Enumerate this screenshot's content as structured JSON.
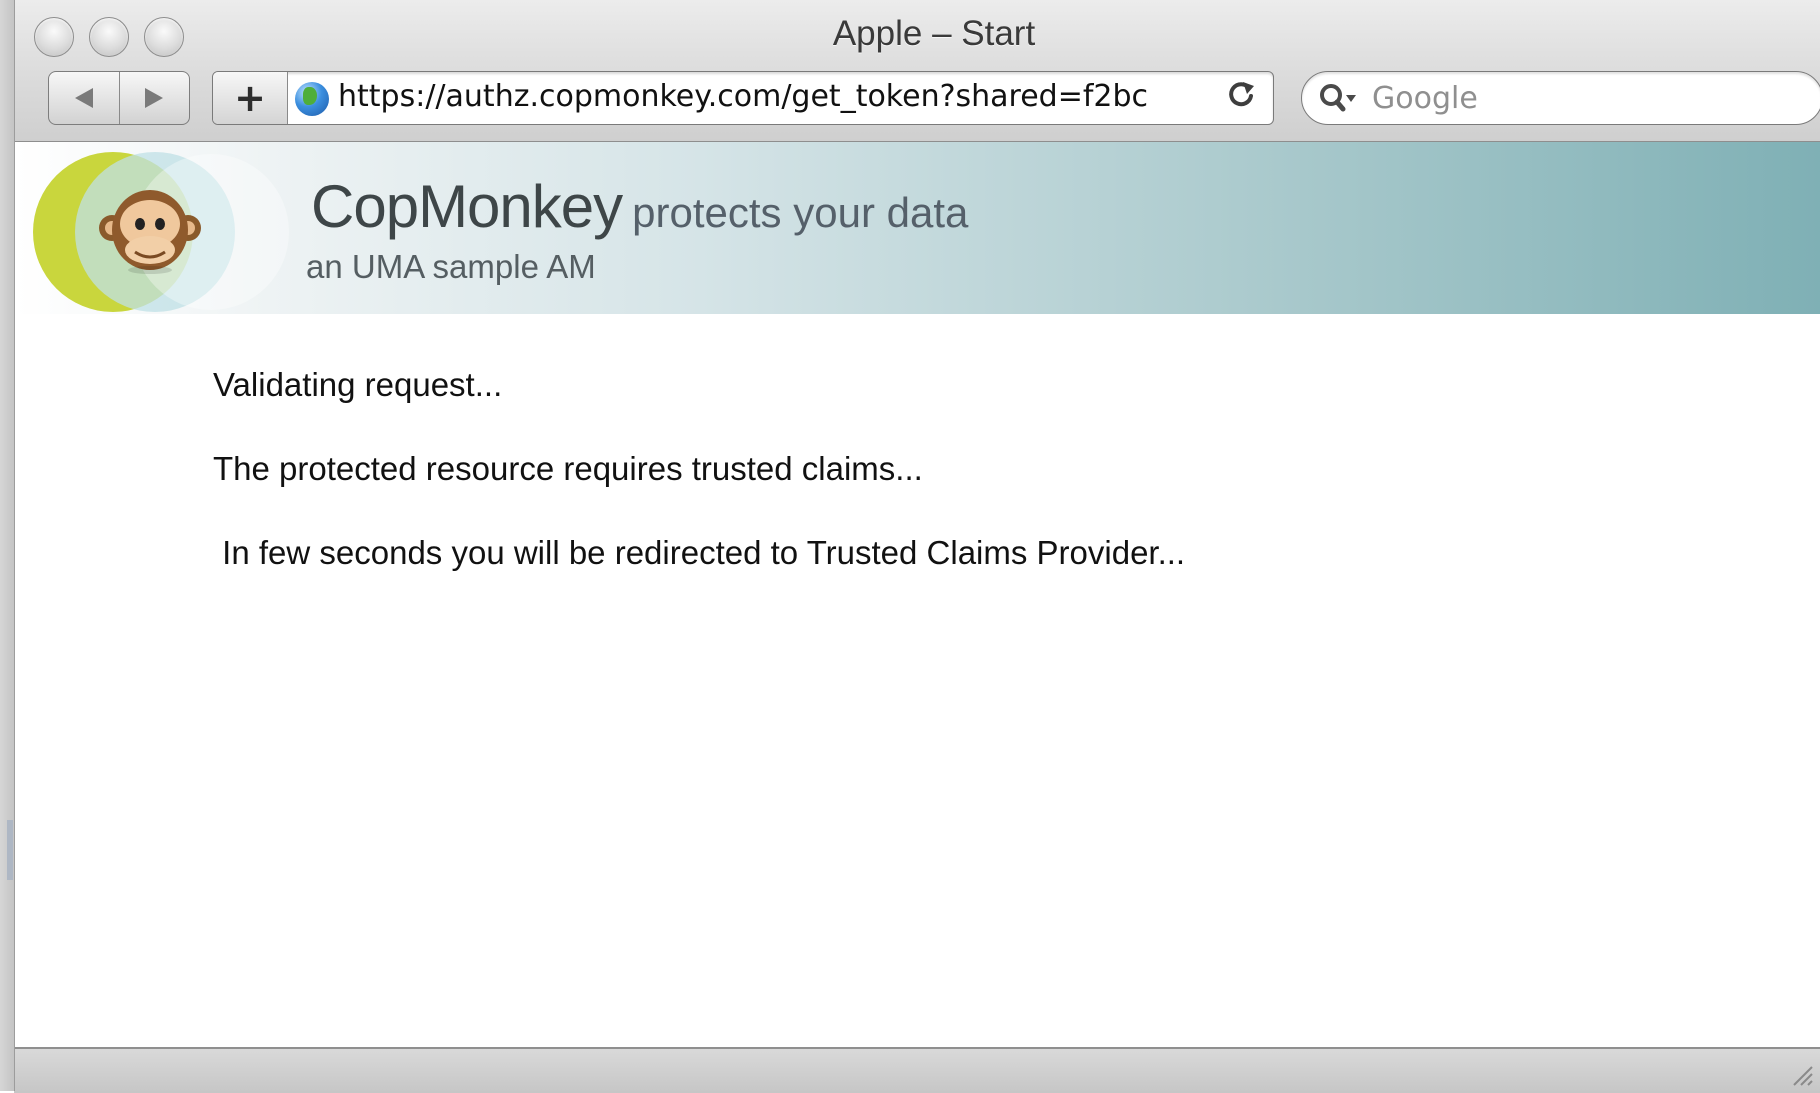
{
  "window": {
    "title": "Apple – Start"
  },
  "toolbar": {
    "back_icon": "back-arrow-icon",
    "forward_icon": "forward-arrow-icon",
    "add_label": "+",
    "url": "https://authz.copmonkey.com/get_token?shared=f2bc",
    "reload_icon": "reload-icon",
    "search_placeholder": "Google"
  },
  "banner": {
    "brand_name": "CopMonkey",
    "tagline": "protects your data",
    "subtitle": "an UMA sample AM",
    "colors": {
      "gradient_start": "#ffffff",
      "gradient_end": "#7fb0b5",
      "logo_yellow": "#c9d63d",
      "logo_blue": "#bfe0e6"
    }
  },
  "messages": [
    "Validating request...",
    "The protected resource requires trusted claims...",
    " In few seconds you will be redirected to Trusted Claims Provider..."
  ]
}
